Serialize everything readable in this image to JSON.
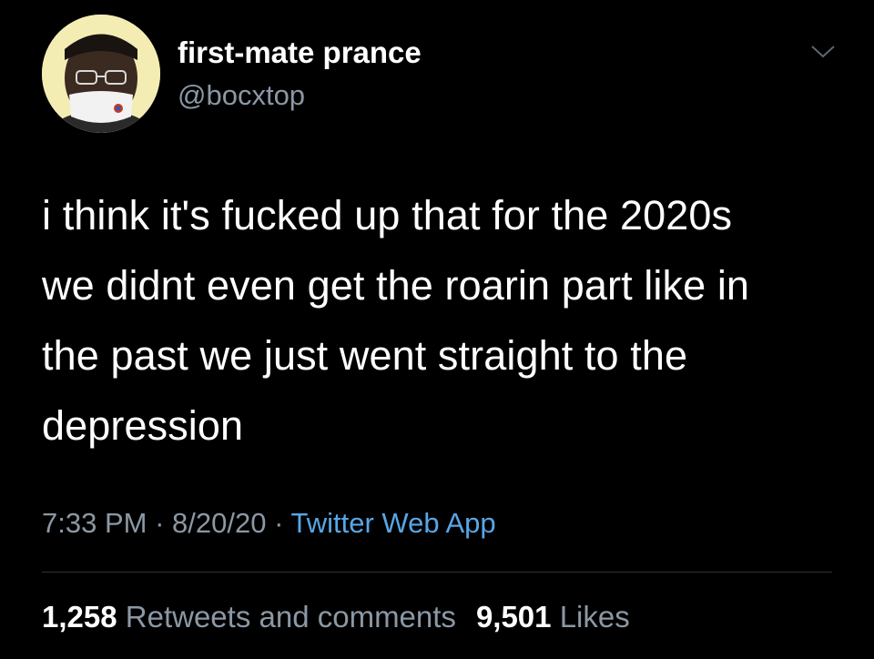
{
  "author": {
    "display_name": "first-mate prance",
    "handle": "@bocxtop"
  },
  "tweet": {
    "text_lines": [
      "i think it's fucked up that for the 2020s",
      "we didnt even get the roarin part like in",
      "the past we just went straight to the",
      "depression"
    ]
  },
  "meta": {
    "time": "7:33 PM",
    "separator": "·",
    "date": "8/20/20",
    "source": "Twitter Web App"
  },
  "stats": {
    "retweets_count": "1,258",
    "retweets_label": "Retweets and comments",
    "likes_count": "9,501",
    "likes_label": "Likes"
  },
  "colors": {
    "background": "#000000",
    "text_primary": "#ffffff",
    "text_secondary": "#8b98a5",
    "link": "#58a6e6",
    "divider": "#2f3336"
  },
  "icons": {
    "more": "chevron-down-icon"
  }
}
